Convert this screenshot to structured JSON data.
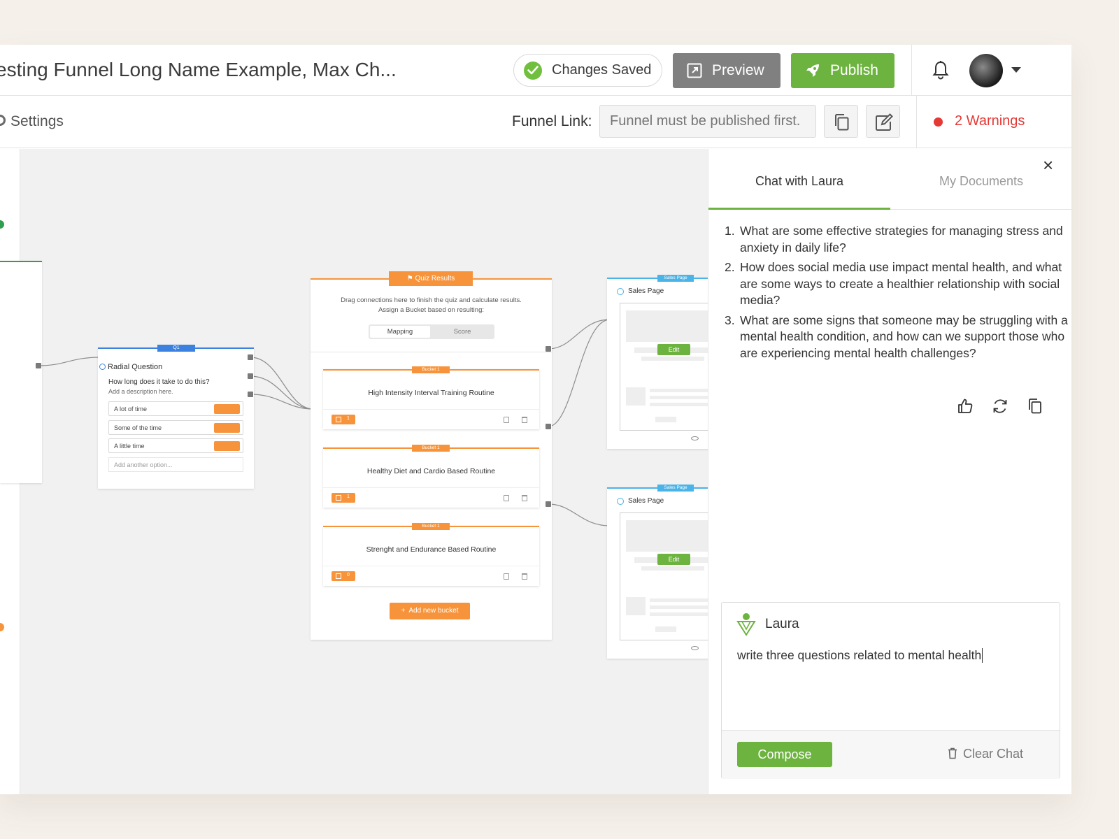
{
  "header": {
    "title": "esting Funnel Long Name Example, Max Ch...",
    "saved_status": "Changes Saved",
    "preview_label": "Preview",
    "publish_label": "Publish"
  },
  "subbar": {
    "settings_label": "Settings",
    "funnel_link_label": "Funnel Link:",
    "funnel_link_placeholder": "Funnel must be published first.",
    "warnings_label": "2 Warnings"
  },
  "canvas": {
    "question": {
      "tag": "Q1",
      "type": "Radial Question",
      "text": "How long does it take to do this?",
      "description": "Add a description here.",
      "options": [
        "A lot of time",
        "Some of the time",
        "A little time"
      ],
      "add_option": "Add another option..."
    },
    "quiz_results": {
      "tag": "Quiz Results",
      "desc_line1": "Drag connections here to finish the quiz and calculate results.",
      "desc_line2": "Assign a Bucket based on resulting:",
      "mapping_label": "Mapping",
      "score_label": "Score",
      "buckets": [
        {
          "tag": "Bucket 1",
          "name": "High Intensity Interval Training Routine",
          "count": "1"
        },
        {
          "tag": "Bucket 1",
          "name": "Healthy Diet and Cardio Based Routine",
          "count": "1"
        },
        {
          "tag": "Bucket 1",
          "name": "Strenght and Endurance Based Routine",
          "count": "0"
        }
      ],
      "add_bucket_label": "Add new bucket"
    },
    "sales_pages": [
      {
        "tag": "Sales Page",
        "title": "Sales Page",
        "edit_label": "Edit"
      },
      {
        "tag": "Sales Page",
        "title": "Sales Page",
        "edit_label": "Edit"
      }
    ]
  },
  "panel": {
    "tab_chat": "Chat with Laura",
    "tab_docs": "My Documents",
    "answers": [
      {
        "num": "1.",
        "text": "What are some effective strategies for managing stress and anxiety in daily life?"
      },
      {
        "num": "2.",
        "text": "How does social media use impact mental health, and what are some ways to create a healthier relationship with social media?"
      },
      {
        "num": "3.",
        "text": "What are some signs that someone may be struggling with a mental health condition, and how can we support those who are experiencing mental health challenges?"
      }
    ],
    "assistant_name": "Laura",
    "prompt": "write three questions related to mental health",
    "compose_label": "Compose",
    "clear_label": "Clear Chat"
  },
  "colors": {
    "green": "#6db33f",
    "orange": "#f7943b",
    "blue": "#3b82e0",
    "light_blue": "#4ab3e8",
    "warning_red": "#e53935",
    "grey_button": "#808080"
  }
}
